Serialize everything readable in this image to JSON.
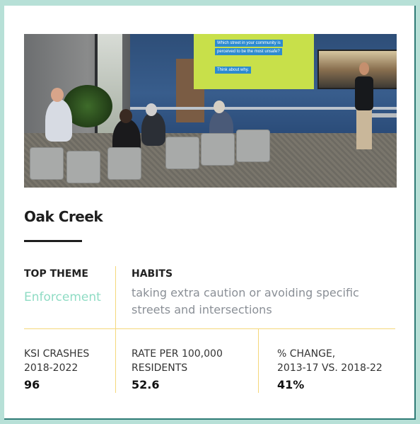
{
  "photo": {
    "alt_icon": "presentation-photo",
    "screen_lines": [
      "Which street in your community is",
      "perceived to be the most unsafe?",
      "Think about why."
    ]
  },
  "card": {
    "title": "Oak Creek",
    "top_theme": {
      "label": "TOP THEME",
      "value": "Enforcement"
    },
    "habits": {
      "label": "HABITS",
      "value": "taking extra caution or avoiding specific streets and intersections"
    },
    "stats": [
      {
        "label_line1": "KSI CRASHES",
        "label_line2": "2018-2022",
        "value": "96"
      },
      {
        "label_line1": "RATE PER 100,000",
        "label_line2": "RESIDENTS",
        "value": "52.6"
      },
      {
        "label_line1": "% CHANGE,",
        "label_line2": "2013-17 VS. 2018-22",
        "value": "41%"
      }
    ]
  },
  "colors": {
    "background": "#b7e0d7",
    "accent_teal": "#8fdcc4",
    "divider_yellow": "#f5d77a",
    "border": "#2f7b76"
  }
}
